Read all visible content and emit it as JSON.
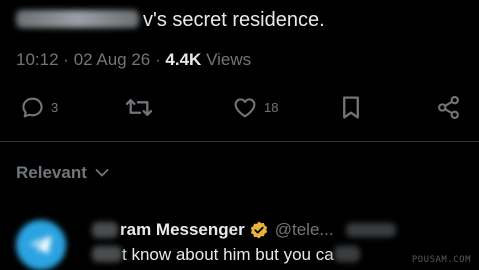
{
  "tweet": {
    "text_visible": "v's secret residence.",
    "time": "10:12",
    "date": "02 Aug 26",
    "views_count": "4.4K",
    "views_label": "Views",
    "sep": "·"
  },
  "actions": {
    "reply_count": "3",
    "likes_count": "18"
  },
  "replies_section": {
    "sort_label": "Relevant"
  },
  "reply": {
    "name": "ram Messenger",
    "handle": "@tele...",
    "text": "t know about him but you ca"
  },
  "watermark": "POUSAM.COM",
  "colors": {
    "background": "#000000",
    "muted": "#71767b",
    "text": "#e7e9ea",
    "verified": "#e8b339",
    "avatar": "#2aa3e0"
  }
}
